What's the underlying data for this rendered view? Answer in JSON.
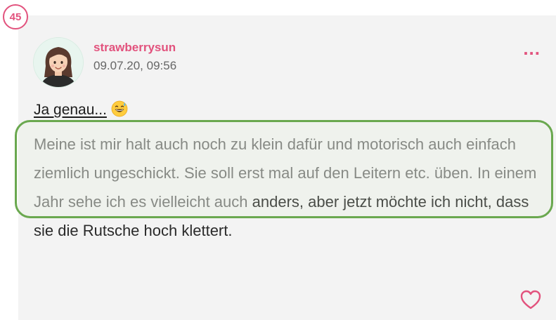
{
  "post": {
    "number": "45",
    "author": "strawberrysun",
    "timestamp": "09.07.20, 09:56",
    "more_menu": "...",
    "quote_line": "Ja genau...",
    "body_faded": "Meine ist mir halt auch noch zu klein dafür und motorisch auch einfach ziemlich ungeschickt. Sie soll erst mal auf den Leitern etc. üben. In einem Jahr sehe ich es vielleicht auch",
    "body_rest": "anders, aber jetzt möchte ich nicht, dass sie die Rutsche hoch klettert."
  },
  "icons": {
    "avatar": "avatar-woman",
    "emoji": "grinning-sweat-emoji",
    "like": "heart-icon"
  },
  "colors": {
    "accent": "#e2527d",
    "highlight_border": "#6aa84f",
    "card_bg": "#f3f3f3"
  }
}
